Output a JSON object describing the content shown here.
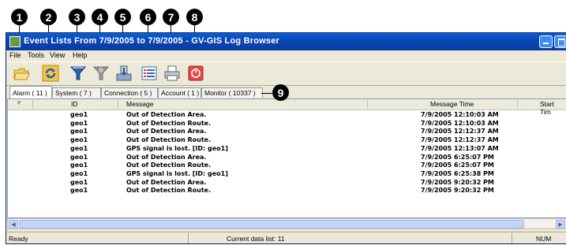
{
  "callouts": [
    "1",
    "2",
    "3",
    "4",
    "5",
    "6",
    "7",
    "8",
    "9"
  ],
  "window": {
    "title": "Event Lists From 7/9/2005 to 7/9/2005 - GV-GIS Log Browser"
  },
  "menu": [
    "File",
    "Tools",
    "View",
    "Help"
  ],
  "toolbar": [
    {
      "name": "open-folder-icon"
    },
    {
      "name": "refresh-icon"
    },
    {
      "name": "filter-icon"
    },
    {
      "name": "clear-filter-icon"
    },
    {
      "name": "export-icon"
    },
    {
      "name": "list-view-icon"
    },
    {
      "name": "print-icon"
    },
    {
      "name": "stop-icon"
    }
  ],
  "tabs": [
    "Alarm ( 11 )",
    "System ( 7 )",
    "Connection ( 5 )",
    "Account ( 1 )",
    "Monitor ( 10337 )"
  ],
  "columns": [
    "ID",
    "Message",
    "Message Time",
    "Start Tim"
  ],
  "rows": [
    {
      "id": "geo1",
      "message": "Out of Detection Area.",
      "time": "7/9/2005 12:10:03 AM"
    },
    {
      "id": "geo1",
      "message": "Out of Detection Route.",
      "time": "7/9/2005 12:10:03 AM"
    },
    {
      "id": "geo1",
      "message": "Out of Detection Area.",
      "time": "7/9/2005 12:12:37 AM"
    },
    {
      "id": "geo1",
      "message": "Out of Detection Route.",
      "time": "7/9/2005 12:12:37 AM"
    },
    {
      "id": "geo1",
      "message": "GPS signal is lost. [ID: geo1]",
      "time": "7/9/2005 12:13:07 AM"
    },
    {
      "id": "geo1",
      "message": "Out of Detection Area.",
      "time": "7/9/2005 6:25:07 PM"
    },
    {
      "id": "geo1",
      "message": "Out of Detection Route.",
      "time": "7/9/2005 6:25:07 PM"
    },
    {
      "id": "geo1",
      "message": "GPS signal is lost. [ID: geo1]",
      "time": "7/9/2005 6:25:38 PM"
    },
    {
      "id": "geo1",
      "message": "Out of Detection Area.",
      "time": "7/9/2005 9:20:32 PM"
    },
    {
      "id": "geo1",
      "message": "Out of Detection Route.",
      "time": "7/9/2005 9:20:32 PM"
    }
  ],
  "status": {
    "left": "Ready",
    "center": "Current data list: 11",
    "right": "NUM"
  }
}
